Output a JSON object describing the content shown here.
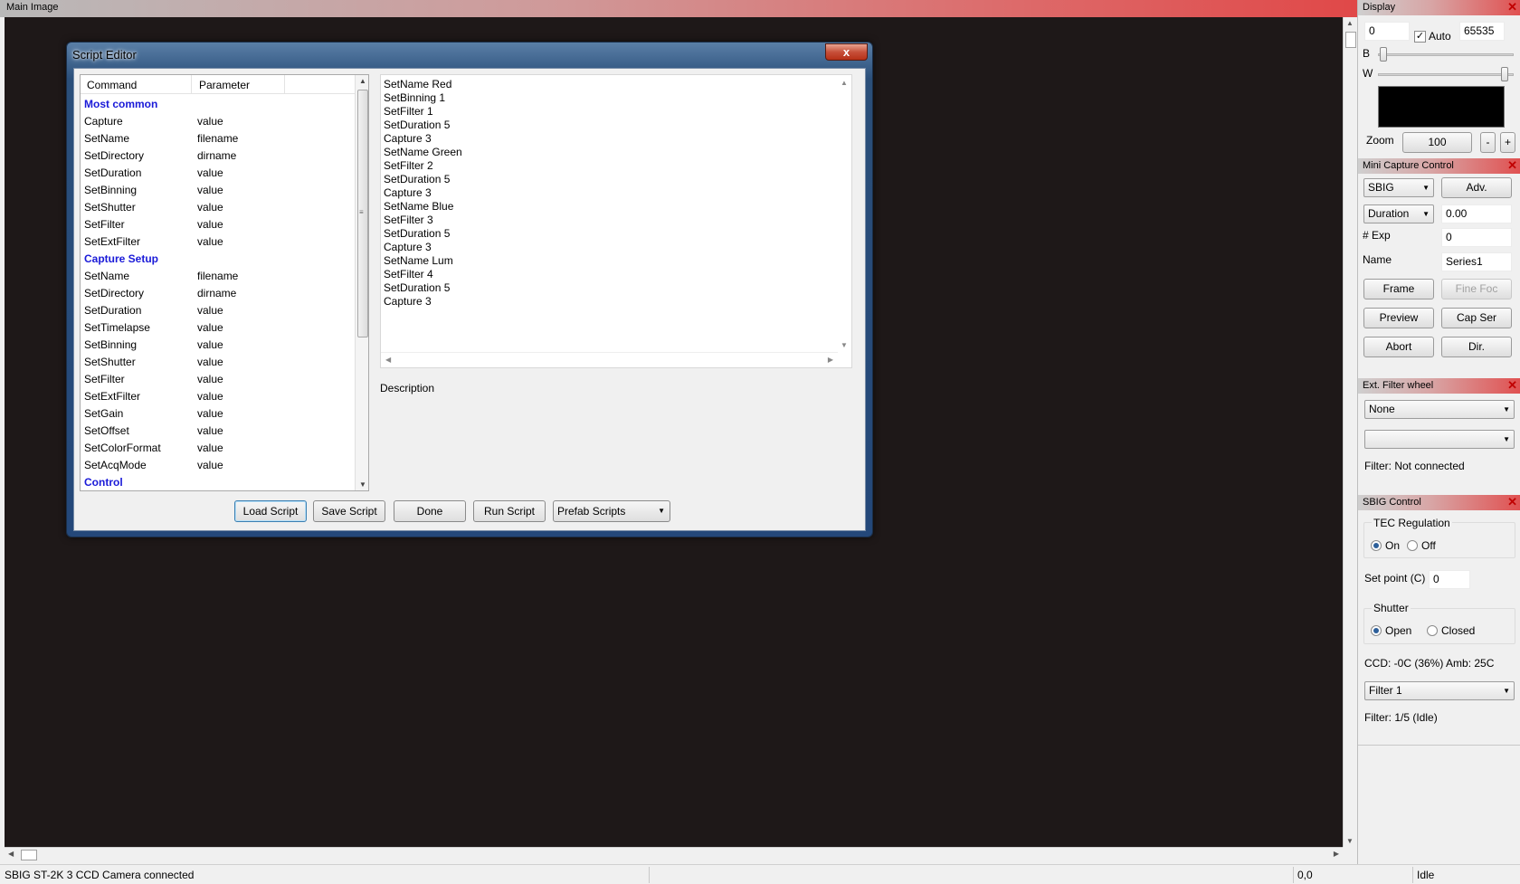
{
  "main": {
    "title": "Main Image"
  },
  "status": {
    "message": "SBIG ST-2K 3 CCD Camera connected",
    "coords": "0,0",
    "state": "Idle"
  },
  "dialog": {
    "title": "Script Editor",
    "close_glyph": "x",
    "command_list": {
      "col_command": "Command",
      "col_parameter": "Parameter",
      "rows": [
        {
          "command": "Most common",
          "parameter": "",
          "group": true
        },
        {
          "command": "Capture",
          "parameter": "value"
        },
        {
          "command": "SetName",
          "parameter": "filename"
        },
        {
          "command": "SetDirectory",
          "parameter": "dirname"
        },
        {
          "command": "SetDuration",
          "parameter": "value"
        },
        {
          "command": "SetBinning",
          "parameter": "value"
        },
        {
          "command": "SetShutter",
          "parameter": "value"
        },
        {
          "command": "SetFilter",
          "parameter": "value"
        },
        {
          "command": "SetExtFilter",
          "parameter": "value"
        },
        {
          "command": "Capture Setup",
          "parameter": "",
          "group": true
        },
        {
          "command": "SetName",
          "parameter": "filename"
        },
        {
          "command": "SetDirectory",
          "parameter": "dirname"
        },
        {
          "command": "SetDuration",
          "parameter": "value"
        },
        {
          "command": "SetTimelapse",
          "parameter": "value"
        },
        {
          "command": "SetBinning",
          "parameter": "value"
        },
        {
          "command": "SetShutter",
          "parameter": "value"
        },
        {
          "command": "SetFilter",
          "parameter": "value"
        },
        {
          "command": "SetExtFilter",
          "parameter": "value"
        },
        {
          "command": "SetGain",
          "parameter": "value"
        },
        {
          "command": "SetOffset",
          "parameter": "value"
        },
        {
          "command": "SetColorFormat",
          "parameter": "value"
        },
        {
          "command": "SetAcqMode",
          "parameter": "value"
        },
        {
          "command": "Control",
          "parameter": "",
          "group": true
        }
      ]
    },
    "script_lines": [
      "SetName Red",
      "SetBinning 1",
      "SetFilter 1",
      "SetDuration 5",
      "Capture 3",
      "SetName Green",
      "SetFilter 2",
      "SetDuration 5",
      "Capture 3",
      "SetName Blue",
      "SetFilter 3",
      "SetDuration 5",
      "Capture 3",
      "SetName Lum",
      "SetFilter 4",
      "SetDuration 5",
      "Capture 3"
    ],
    "description_label": "Description",
    "buttons": {
      "load": "Load Script",
      "save": "Save Script",
      "done": "Done",
      "run": "Run Script"
    },
    "prefab_combo": "Prefab Scripts"
  },
  "display_panel": {
    "title": "Display",
    "black_value": "0",
    "auto_label": "Auto",
    "auto_checked": true,
    "white_value": "65535",
    "b_label": "B",
    "w_label": "W",
    "zoom_label": "Zoom",
    "zoom_value": "100",
    "zoom_minus": "-",
    "zoom_plus": "+"
  },
  "capture_panel": {
    "title": "Mini Capture Control",
    "camera_combo": "SBIG",
    "adv_button": "Adv.",
    "mode_combo": "Duration",
    "duration_value": "0.00",
    "exp_label": "# Exp",
    "exp_value": "0",
    "name_label": "Name",
    "name_value": "Series1",
    "frame_button": "Frame",
    "finefoc_button": "Fine Foc",
    "preview_button": "Preview",
    "capser_button": "Cap Ser",
    "abort_button": "Abort",
    "dir_button": "Dir."
  },
  "filter_panel": {
    "title": "Ext. Filter wheel",
    "wheel_combo": "None",
    "filter_combo": "",
    "status": "Filter: Not connected"
  },
  "sbig_panel": {
    "title": "SBIG Control",
    "tec_group": "TEC Regulation",
    "tec_on": "On",
    "tec_off": "Off",
    "setpoint_label": "Set point (C)",
    "setpoint_value": "0",
    "shutter_group": "Shutter",
    "shutter_open": "Open",
    "shutter_closed": "Closed",
    "ccd_status": "CCD: -0C (36%) Amb: 25C",
    "filter_combo": "Filter 1",
    "filter_status": "Filter: 1/5 (Idle)"
  }
}
